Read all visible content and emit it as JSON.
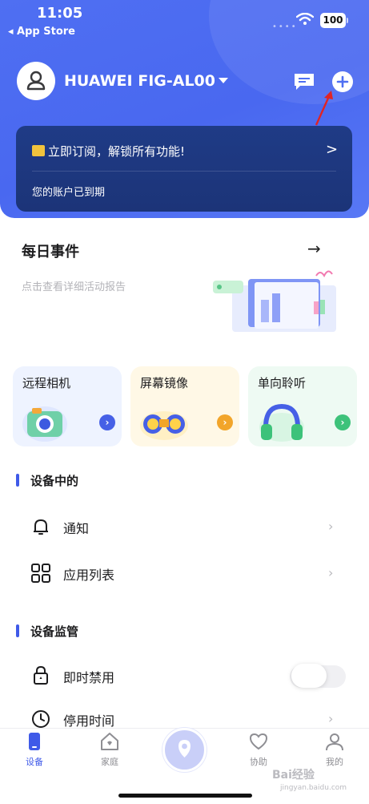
{
  "status_bar": {
    "time": "11:05",
    "back_app": "◂ App Store",
    "battery": "100"
  },
  "header": {
    "device_name": "HUAWEI FIG-AL00"
  },
  "subscription": {
    "promo": "立即订阅，解锁所有功能!",
    "expired": "您的账户已到期"
  },
  "daily_events": {
    "title": "每日事件",
    "subtitle": "点击查看详细活动报告"
  },
  "feature_cards": [
    {
      "label": "远程相机",
      "bg": "#eef3ff",
      "accent": "#4660e6"
    },
    {
      "label": "屏幕镜像",
      "bg": "#fff8e6",
      "accent": "#f2a52a"
    },
    {
      "label": "单向聆听",
      "bg": "#eefaf3",
      "accent": "#3dc27a"
    }
  ],
  "sections": [
    {
      "title": "设备中的",
      "items": [
        {
          "label": "通知",
          "icon": "bell-icon"
        },
        {
          "label": "应用列表",
          "icon": "grid-icon"
        }
      ]
    },
    {
      "title": "设备监管",
      "items": [
        {
          "label": "即时禁用",
          "icon": "lock-icon"
        },
        {
          "label": "停用时间",
          "icon": "clock-icon"
        }
      ]
    }
  ],
  "tabs": [
    {
      "label": "设备",
      "icon": "device-icon",
      "active": true
    },
    {
      "label": "家庭",
      "icon": "home-icon"
    },
    {
      "label": "",
      "icon": "location-icon"
    },
    {
      "label": "协助",
      "icon": "heart-icon"
    },
    {
      "label": "我的",
      "icon": "profile-icon"
    }
  ],
  "watermark": {
    "brand": "Bai经验",
    "sub": "jingyan.baidu.com"
  },
  "colors": {
    "header": "#4f6ff2",
    "card": "#1f3b86",
    "accent": "#3f5ae8"
  }
}
